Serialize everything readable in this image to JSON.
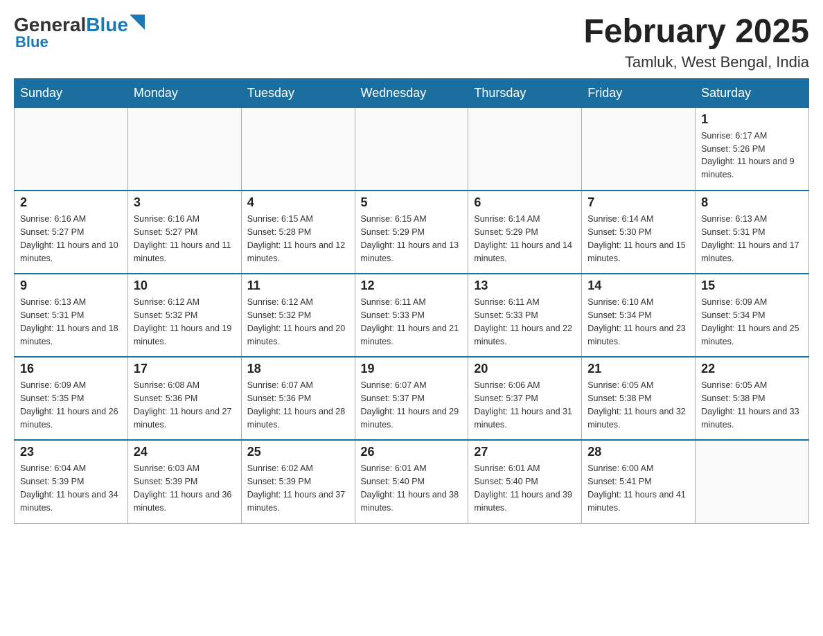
{
  "header": {
    "logo_text_general": "General",
    "logo_text_blue": "Blue",
    "month_title": "February 2025",
    "location": "Tamluk, West Bengal, India"
  },
  "days_of_week": [
    "Sunday",
    "Monday",
    "Tuesday",
    "Wednesday",
    "Thursday",
    "Friday",
    "Saturday"
  ],
  "weeks": [
    [
      {
        "day": "",
        "info": ""
      },
      {
        "day": "",
        "info": ""
      },
      {
        "day": "",
        "info": ""
      },
      {
        "day": "",
        "info": ""
      },
      {
        "day": "",
        "info": ""
      },
      {
        "day": "",
        "info": ""
      },
      {
        "day": "1",
        "info": "Sunrise: 6:17 AM\nSunset: 5:26 PM\nDaylight: 11 hours and 9 minutes."
      }
    ],
    [
      {
        "day": "2",
        "info": "Sunrise: 6:16 AM\nSunset: 5:27 PM\nDaylight: 11 hours and 10 minutes."
      },
      {
        "day": "3",
        "info": "Sunrise: 6:16 AM\nSunset: 5:27 PM\nDaylight: 11 hours and 11 minutes."
      },
      {
        "day": "4",
        "info": "Sunrise: 6:15 AM\nSunset: 5:28 PM\nDaylight: 11 hours and 12 minutes."
      },
      {
        "day": "5",
        "info": "Sunrise: 6:15 AM\nSunset: 5:29 PM\nDaylight: 11 hours and 13 minutes."
      },
      {
        "day": "6",
        "info": "Sunrise: 6:14 AM\nSunset: 5:29 PM\nDaylight: 11 hours and 14 minutes."
      },
      {
        "day": "7",
        "info": "Sunrise: 6:14 AM\nSunset: 5:30 PM\nDaylight: 11 hours and 15 minutes."
      },
      {
        "day": "8",
        "info": "Sunrise: 6:13 AM\nSunset: 5:31 PM\nDaylight: 11 hours and 17 minutes."
      }
    ],
    [
      {
        "day": "9",
        "info": "Sunrise: 6:13 AM\nSunset: 5:31 PM\nDaylight: 11 hours and 18 minutes."
      },
      {
        "day": "10",
        "info": "Sunrise: 6:12 AM\nSunset: 5:32 PM\nDaylight: 11 hours and 19 minutes."
      },
      {
        "day": "11",
        "info": "Sunrise: 6:12 AM\nSunset: 5:32 PM\nDaylight: 11 hours and 20 minutes."
      },
      {
        "day": "12",
        "info": "Sunrise: 6:11 AM\nSunset: 5:33 PM\nDaylight: 11 hours and 21 minutes."
      },
      {
        "day": "13",
        "info": "Sunrise: 6:11 AM\nSunset: 5:33 PM\nDaylight: 11 hours and 22 minutes."
      },
      {
        "day": "14",
        "info": "Sunrise: 6:10 AM\nSunset: 5:34 PM\nDaylight: 11 hours and 23 minutes."
      },
      {
        "day": "15",
        "info": "Sunrise: 6:09 AM\nSunset: 5:34 PM\nDaylight: 11 hours and 25 minutes."
      }
    ],
    [
      {
        "day": "16",
        "info": "Sunrise: 6:09 AM\nSunset: 5:35 PM\nDaylight: 11 hours and 26 minutes."
      },
      {
        "day": "17",
        "info": "Sunrise: 6:08 AM\nSunset: 5:36 PM\nDaylight: 11 hours and 27 minutes."
      },
      {
        "day": "18",
        "info": "Sunrise: 6:07 AM\nSunset: 5:36 PM\nDaylight: 11 hours and 28 minutes."
      },
      {
        "day": "19",
        "info": "Sunrise: 6:07 AM\nSunset: 5:37 PM\nDaylight: 11 hours and 29 minutes."
      },
      {
        "day": "20",
        "info": "Sunrise: 6:06 AM\nSunset: 5:37 PM\nDaylight: 11 hours and 31 minutes."
      },
      {
        "day": "21",
        "info": "Sunrise: 6:05 AM\nSunset: 5:38 PM\nDaylight: 11 hours and 32 minutes."
      },
      {
        "day": "22",
        "info": "Sunrise: 6:05 AM\nSunset: 5:38 PM\nDaylight: 11 hours and 33 minutes."
      }
    ],
    [
      {
        "day": "23",
        "info": "Sunrise: 6:04 AM\nSunset: 5:39 PM\nDaylight: 11 hours and 34 minutes."
      },
      {
        "day": "24",
        "info": "Sunrise: 6:03 AM\nSunset: 5:39 PM\nDaylight: 11 hours and 36 minutes."
      },
      {
        "day": "25",
        "info": "Sunrise: 6:02 AM\nSunset: 5:39 PM\nDaylight: 11 hours and 37 minutes."
      },
      {
        "day": "26",
        "info": "Sunrise: 6:01 AM\nSunset: 5:40 PM\nDaylight: 11 hours and 38 minutes."
      },
      {
        "day": "27",
        "info": "Sunrise: 6:01 AM\nSunset: 5:40 PM\nDaylight: 11 hours and 39 minutes."
      },
      {
        "day": "28",
        "info": "Sunrise: 6:00 AM\nSunset: 5:41 PM\nDaylight: 11 hours and 41 minutes."
      },
      {
        "day": "",
        "info": ""
      }
    ]
  ]
}
